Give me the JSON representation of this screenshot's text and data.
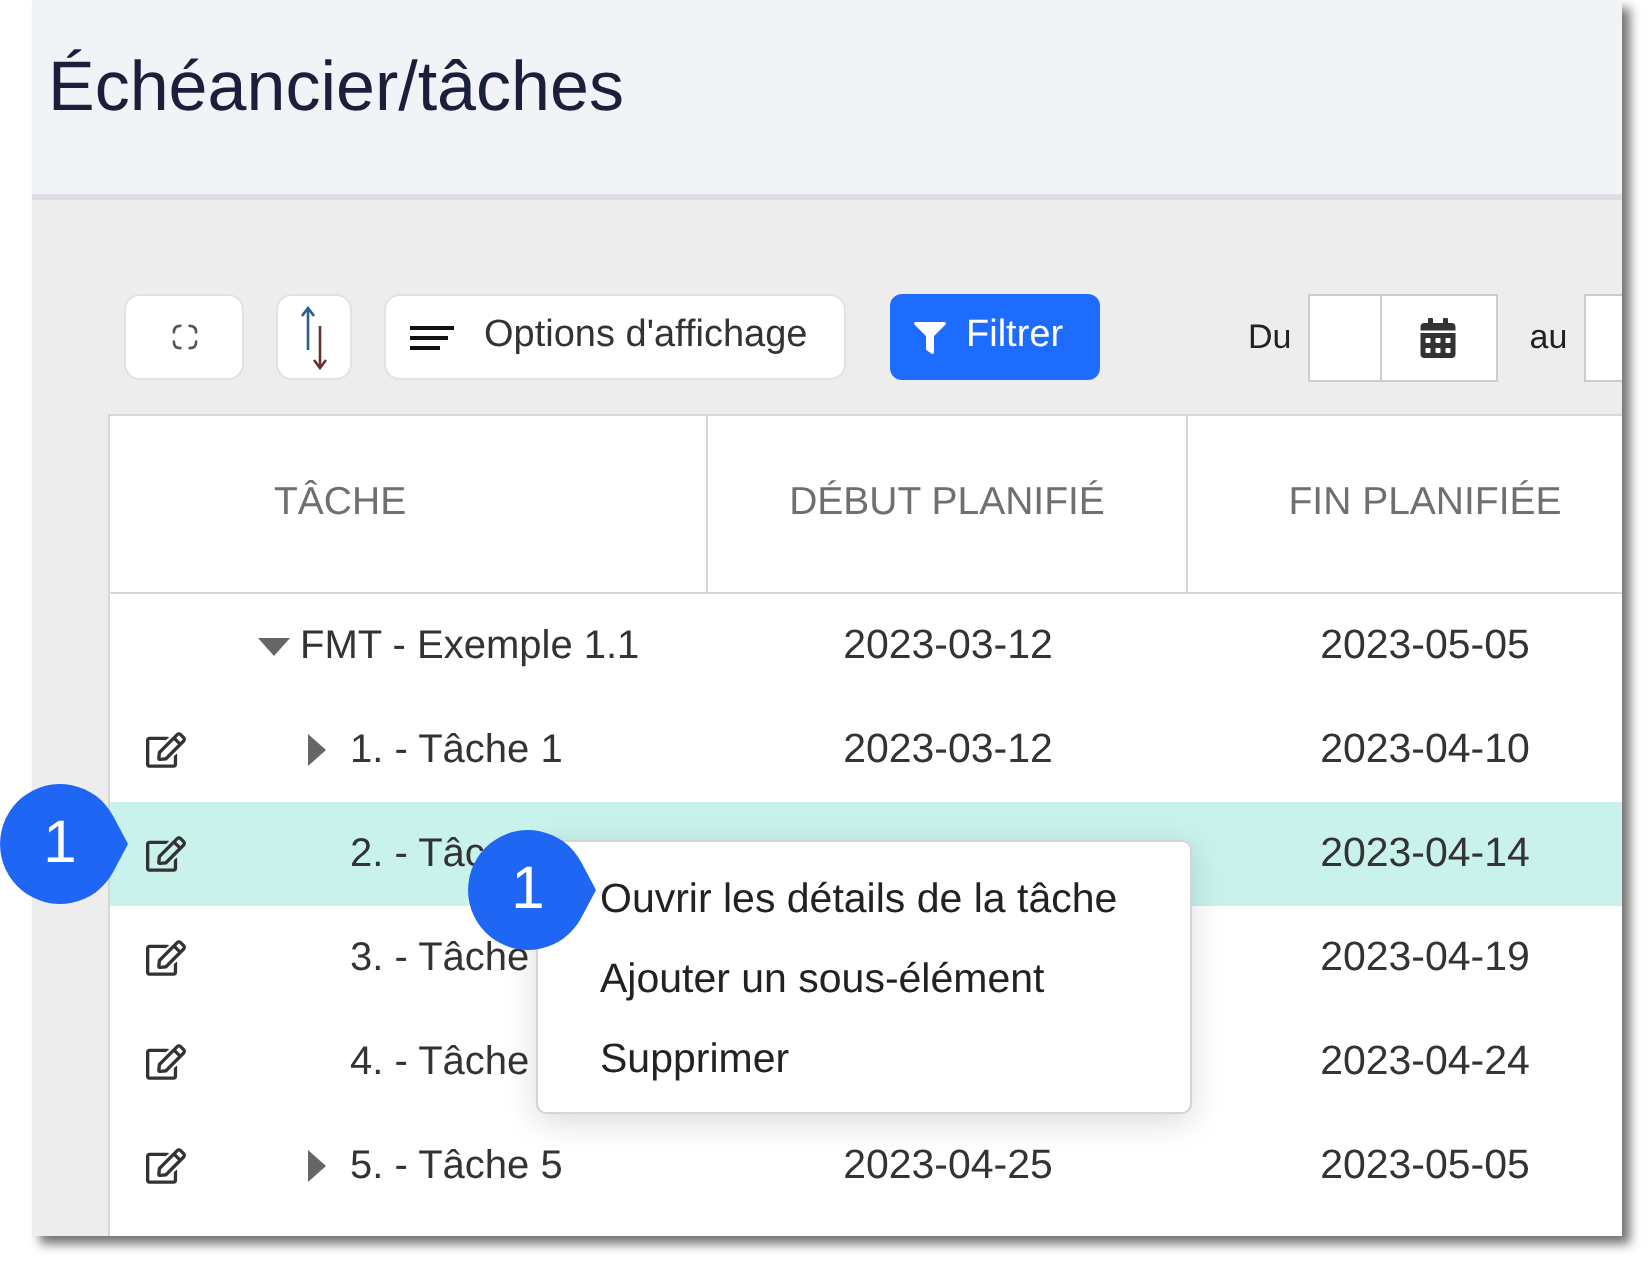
{
  "page": {
    "title": "Échéancier/tâches"
  },
  "toolbar": {
    "display_options": "Options d'affichage",
    "filter": "Filtrer",
    "from_label": "Du",
    "to_label": "au"
  },
  "table": {
    "columns": [
      "TÂCHE",
      "DÉBUT PLANIFIÉ",
      "FIN PLANIFIÉE"
    ],
    "rows": [
      {
        "task": "FMT - Exemple 1.1",
        "start": "2023-03-12",
        "end": "2023-05-05",
        "expanded": true,
        "selected": false,
        "children": [
          {
            "task": "1. - Tâche 1",
            "start": "2023-03-12",
            "end": "2023-04-10",
            "expanded": false,
            "selected": false
          },
          {
            "task": "2. - Tâc",
            "end": "2023-04-14",
            "selected": true
          },
          {
            "task": "3. - Tâche",
            "end": "2023-04-19",
            "selected": false
          },
          {
            "task": "4. - Tâche",
            "end": "2023-04-24",
            "selected": false
          },
          {
            "task": "5. - Tâche 5",
            "start": "2023-04-25",
            "end": "2023-05-05",
            "expanded": false,
            "selected": false
          }
        ]
      }
    ]
  },
  "context_menu": {
    "items": [
      "Ouvrir les détails de la tâche",
      "Ajouter un sous-élément",
      "Supprimer"
    ]
  },
  "callouts": [
    {
      "number": "1"
    },
    {
      "number": "1"
    }
  ]
}
